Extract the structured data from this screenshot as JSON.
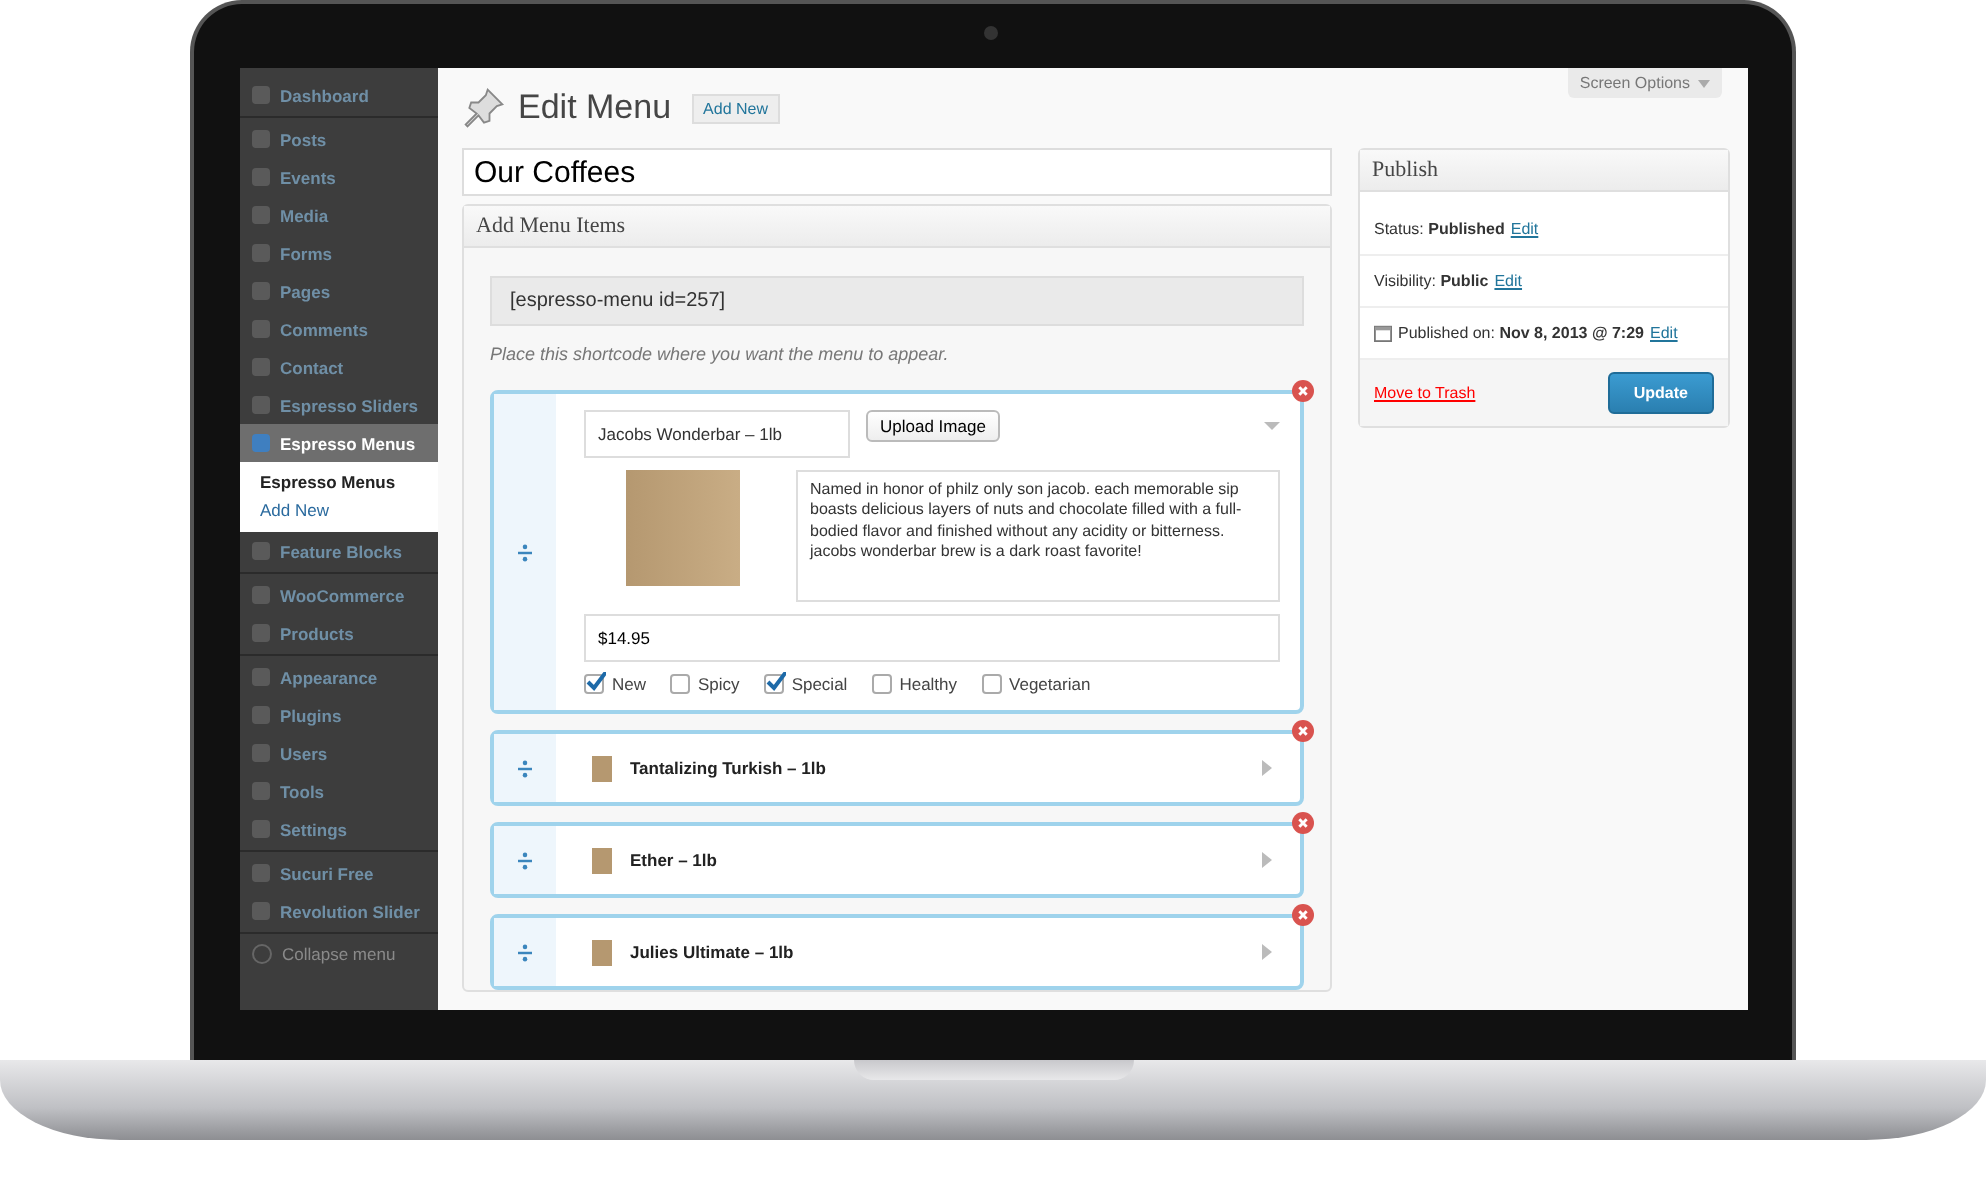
{
  "sidebar": {
    "groups": [
      {
        "items": [
          {
            "label": "Dashboard",
            "selected": false
          }
        ]
      },
      {
        "items": [
          {
            "label": "Posts",
            "selected": false
          },
          {
            "label": "Events",
            "selected": false
          },
          {
            "label": "Media",
            "selected": false
          },
          {
            "label": "Forms",
            "selected": false
          },
          {
            "label": "Pages",
            "selected": false
          },
          {
            "label": "Comments",
            "selected": false
          },
          {
            "label": "Contact",
            "selected": false
          },
          {
            "label": "Espresso Sliders",
            "selected": false
          },
          {
            "label": "Espresso Menus",
            "selected": true,
            "children": [
              {
                "label": "Espresso Menus",
                "selected": true
              },
              {
                "label": "Add New",
                "selected": false
              }
            ]
          },
          {
            "label": "Feature Blocks",
            "selected": false
          }
        ]
      },
      {
        "items": [
          {
            "label": "WooCommerce",
            "selected": false
          },
          {
            "label": "Products",
            "selected": false
          }
        ]
      },
      {
        "items": [
          {
            "label": "Appearance",
            "selected": false
          },
          {
            "label": "Plugins",
            "selected": false
          },
          {
            "label": "Users",
            "selected": false
          },
          {
            "label": "Tools",
            "selected": false
          },
          {
            "label": "Settings",
            "selected": false
          }
        ]
      },
      {
        "items": [
          {
            "label": "Sucuri Free",
            "selected": false
          },
          {
            "label": "Revolution Slider",
            "selected": false
          }
        ]
      }
    ],
    "collapse": "Collapse menu"
  },
  "header": {
    "title": "Edit Menu",
    "add_new": "Add New",
    "screen_options": "Screen Options"
  },
  "menu_title": "Our Coffees",
  "add_menu_items": {
    "heading": "Add Menu Items",
    "shortcode": "[espresso-menu id=257]",
    "hint": "Place this shortcode where you want the menu to appear.",
    "items": [
      {
        "name": "Jacobs Wonderbar – 1lb",
        "expanded": true,
        "upload": "Upload Image",
        "description": "Named in honor of philz only son jacob. each memorable sip boasts delicious layers of nuts and chocolate filled with a full-bodied flavor and finished without any acidity or bitterness. jacobs wonderbar brew is a dark roast favorite!",
        "price": "$14.95",
        "tags": [
          {
            "label": "New",
            "checked": true
          },
          {
            "label": "Spicy",
            "checked": false
          },
          {
            "label": "Special",
            "checked": true
          },
          {
            "label": "Healthy",
            "checked": false
          },
          {
            "label": "Vegetarian",
            "checked": false
          }
        ]
      },
      {
        "name": "Tantalizing Turkish – 1lb",
        "expanded": false
      },
      {
        "name": "Ether – 1lb",
        "expanded": false
      },
      {
        "name": "Julies Ultimate – 1lb",
        "expanded": false
      }
    ]
  },
  "publish": {
    "heading": "Publish",
    "status_label": "Status:",
    "status": "Published",
    "visibility_label": "Visibility:",
    "visibility": "Public",
    "published_label": "Published on:",
    "published": "Nov 8, 2013 @ 7:29",
    "status_edit": "Edit",
    "visibility_edit": "Edit",
    "published_edit": "Edit",
    "trash": "Move to Trash",
    "update": "Update"
  }
}
